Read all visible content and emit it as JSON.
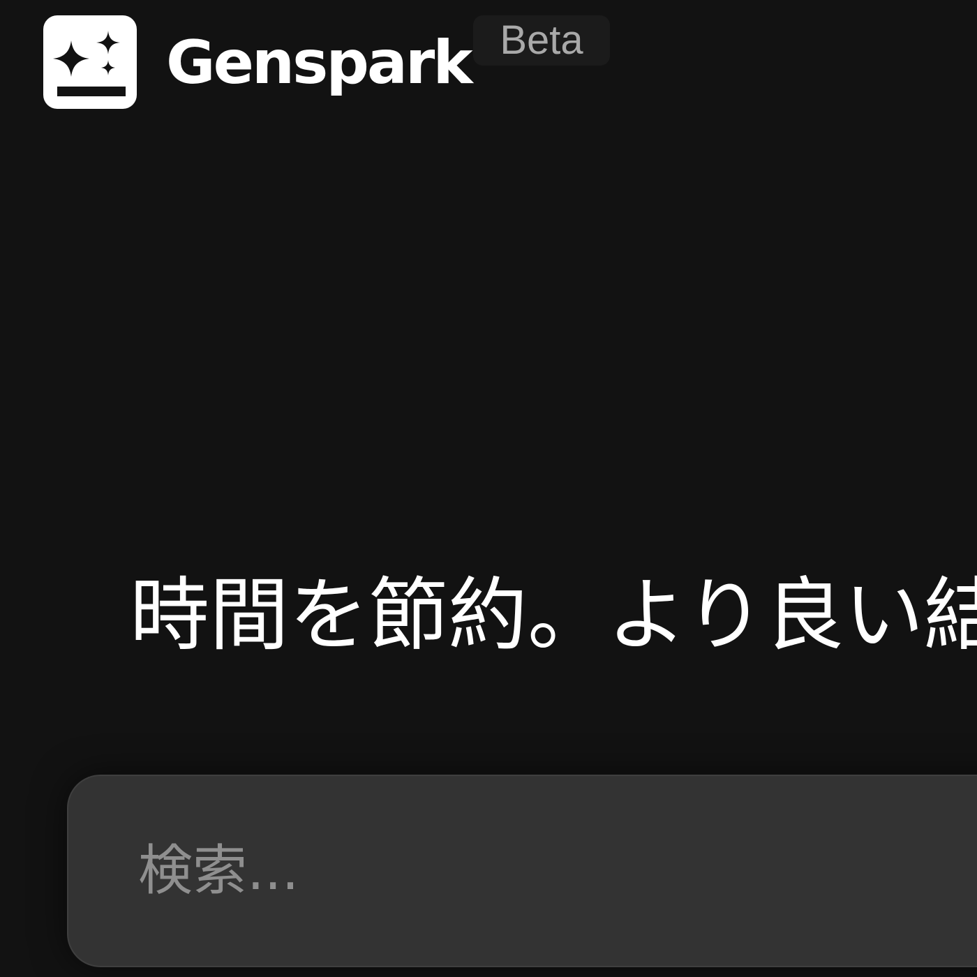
{
  "brand": {
    "name": "Genspark",
    "badge": "Beta",
    "logo_icon": "sparkles-icon"
  },
  "hero": {
    "headline": "時間を節約。より良い結"
  },
  "search": {
    "placeholder": "検索...",
    "value": ""
  },
  "colors": {
    "background": "#121212",
    "search_box": "#333333",
    "badge_background": "#1b1b1b",
    "badge_text": "#a9a9a9",
    "placeholder_text": "#8f8f8f",
    "primary_text": "#ffffff"
  }
}
